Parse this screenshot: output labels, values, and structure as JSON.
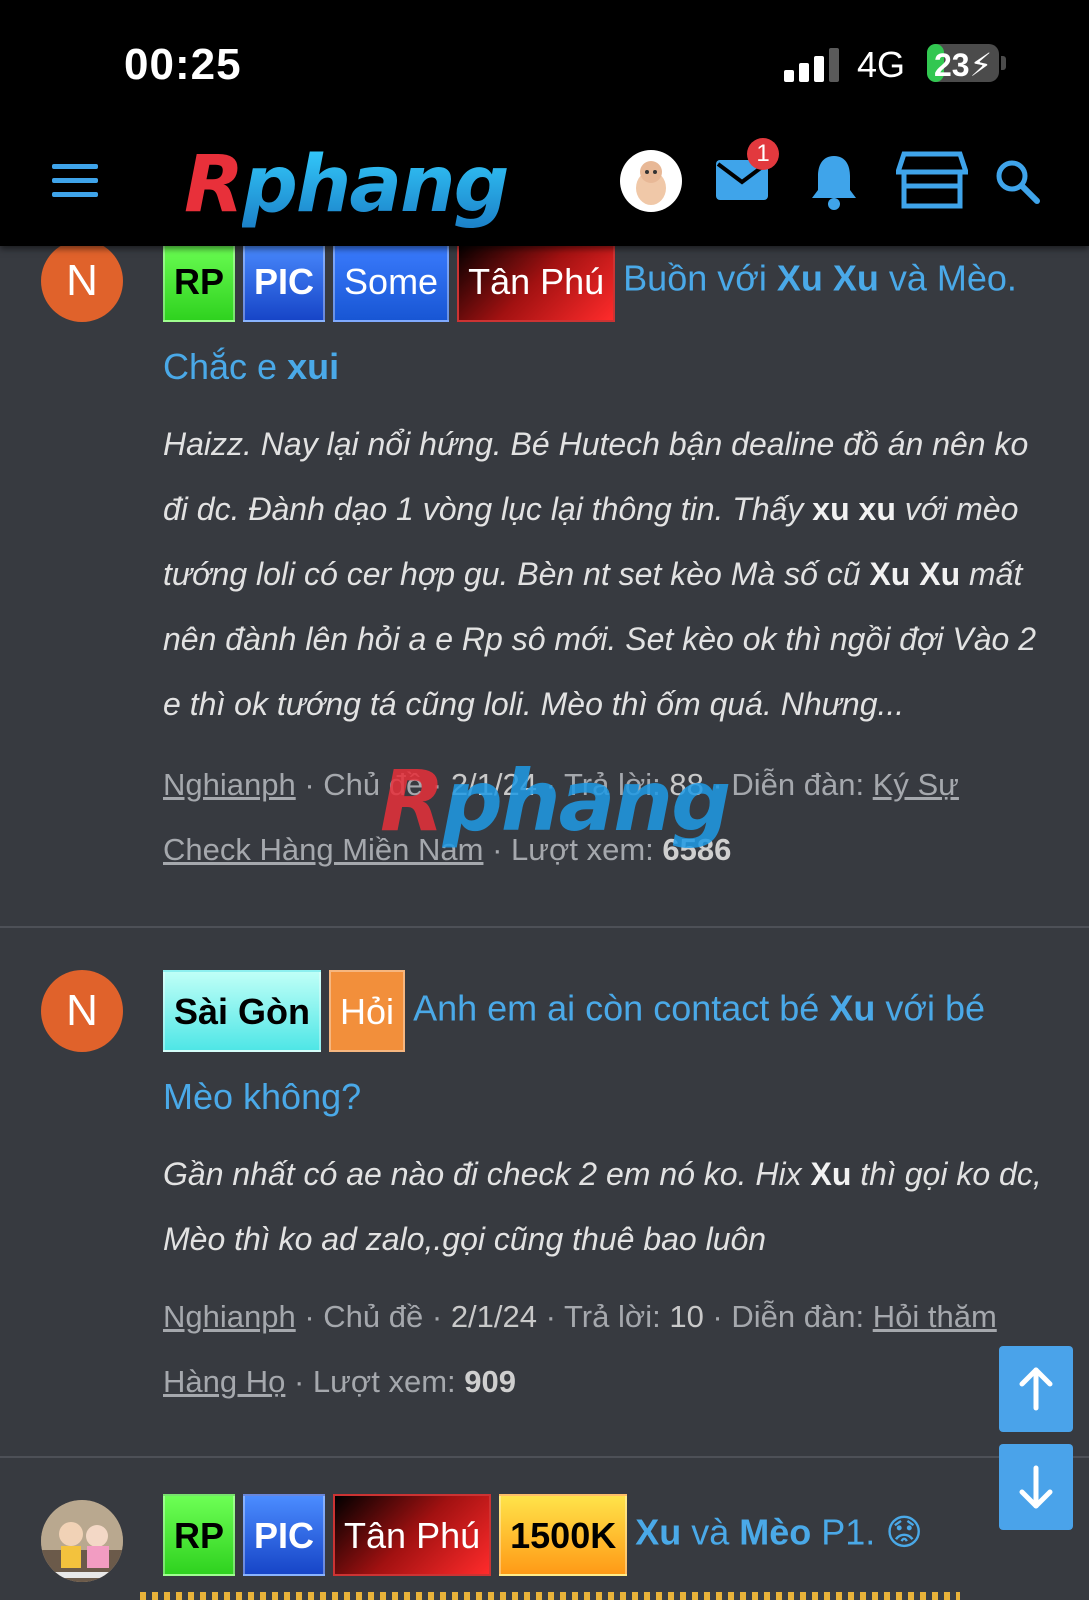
{
  "status_bar": {
    "time": "00:25",
    "network": "4G",
    "battery": "23",
    "battery_level": 0.23,
    "signal_bars": 3
  },
  "header": {
    "logo": {
      "r": "R",
      "rest": "phang"
    },
    "mail_badge": "1"
  },
  "watermark": {
    "r": "R",
    "rest": "phang"
  },
  "threads": [
    {
      "avatar": "N",
      "prefixes": [
        "RP",
        "PIC",
        "Some",
        "Tân Phú"
      ],
      "title": {
        "p1": "Buồn với ",
        "b1": "Xu Xu",
        "p2": " và Mèo.",
        "l2a": "Chắc e ",
        "l2b": "xui"
      },
      "snippet": {
        "s1": "Haizz. Nay lại nổi hứng. Bé Hutech bận dealine đồ án nên ko đi dc. Đành dạo 1 vòng lục lại thông tin. Thấy ",
        "b1": "xu xu",
        "s2": " với mèo tướng loli có cer hợp gu. Bèn nt set kèo Mà số cũ ",
        "b2": "Xu Xu",
        "s3": " mất nên đành lên hỏi a e Rp sô mới. Set kèo ok thì ngồi đợi Vào 2 e thì ok tướng tá cũng loli. Mèo thì ốm quá. Nhưng..."
      },
      "meta": {
        "author": "Nghianph",
        "type": "Chủ đề",
        "date": "2/1/24",
        "replies_label": "Trả lời:",
        "replies": "88",
        "forum_label": "Diễn đàn:",
        "forum": "Ký Sự Check Hàng Miền Nam",
        "views_label": "Lượt xem:",
        "views": "6586"
      }
    },
    {
      "avatar": "N",
      "prefixes": [
        "Sài Gòn",
        "Hỏi"
      ],
      "title": {
        "p1": "Anh em ai còn contact bé ",
        "b1": "Xu",
        "p2": " với bé",
        "l2a": "Mèo không?"
      },
      "snippet": {
        "s1": "Gần nhất có ae nào đi check 2 em nó ko. Hix ",
        "b1": "Xu",
        "s2": " thì gọi ko dc, Mèo thì ko ad zalo,.gọi cũng thuê bao luôn"
      },
      "meta": {
        "author": "Nghianph",
        "type": "Chủ đề",
        "date": "2/1/24",
        "replies_label": "Trả lời:",
        "replies": "10",
        "forum_label": "Diễn đàn:",
        "forum": "Hỏi thăm Hàng Họ",
        "views_label": "Lượt xem:",
        "views": "909"
      }
    },
    {
      "prefixes": [
        "RP",
        "PIC",
        "Tân Phú",
        "1500K"
      ],
      "title": {
        "b1": "Xu",
        "p1": " và ",
        "b2": "Mèo",
        "p2": " P1.",
        "emoji": "😟"
      }
    }
  ]
}
